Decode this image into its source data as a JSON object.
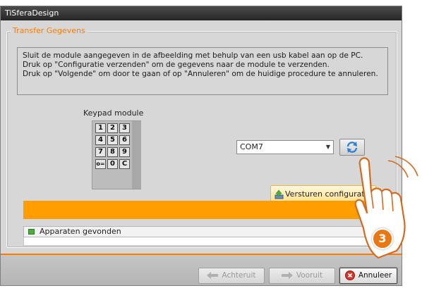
{
  "window": {
    "title": "TiSferaDesign"
  },
  "group": {
    "title": "Transfer Gegevens"
  },
  "instructions": [
    "Sluit de module aangegeven in de afbeelding met behulp van een usb kabel aan op de PC.",
    "Druk op \"Configuratie verzenden\" om de gegevens naar de module te verzenden.",
    "Druk op \"Volgende\" om door te gaan of op \"Annuleren\" om de huidige procedure te annuleren."
  ],
  "keypad": {
    "label": "Keypad module",
    "keys": [
      "1",
      "2",
      "3",
      "4",
      "5",
      "6",
      "7",
      "8",
      "9",
      "o=",
      "0",
      "C"
    ]
  },
  "port": {
    "selected": "COM7",
    "refresh_icon": "refresh-icon"
  },
  "send_button": {
    "label": "Versturen configuratie",
    "icon": "upload-icon"
  },
  "progress": {
    "percent": 100,
    "color": "#ff9c00"
  },
  "devices": {
    "label": "Apparaten gevonden",
    "icon": "device-found-icon",
    "status_color": "#4fae3b"
  },
  "footer": {
    "back_label": "Achteruit",
    "next_label": "Vooruit",
    "cancel_label": "Annuleer"
  },
  "step_badge": {
    "number": "3",
    "color": "#e87814"
  },
  "accent_color": "#ff7a00"
}
